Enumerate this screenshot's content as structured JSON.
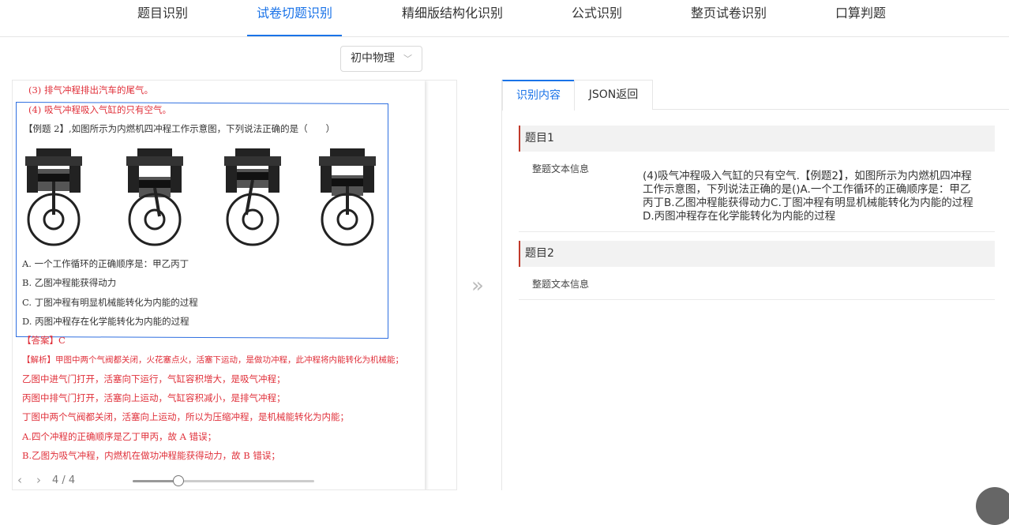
{
  "top_tabs": [
    {
      "label": "题目识别"
    },
    {
      "label": "试卷切题识别"
    },
    {
      "label": "精细版结构化识别"
    },
    {
      "label": "公式识别"
    },
    {
      "label": "整页试卷识别"
    },
    {
      "label": "口算判题"
    }
  ],
  "subject_select": {
    "value": "初中物理"
  },
  "document": {
    "lines": [
      "(3) 排气冲程排出汽车的尾气。",
      "(4) 吸气冲程吸入气缸的只有空气。",
      "【例题 2】,如图所示为内燃机四冲程工作示意图，下列说法正确的是（　　）",
      "A.  一个工作循环的正确顺序是：甲乙丙丁",
      "B.  乙图冲程能获得动力",
      "C.  丁图冲程有明显机械能转化为内能的过程",
      "D.  丙图冲程存在化学能转化为内能的过程",
      "【答案】C",
      "【解析】甲图中两个气阀都关闭，火花塞点火，活塞下运动，是做功冲程，此冲程将内能转化为机械能；",
      "乙图中进气门打开，活塞向下运行，气缸容积增大，是吸气冲程；",
      "丙图中排气门打开，活塞向上运动，气缸容积减小，是排气冲程；",
      "丁图中两个气阀都关闭，活塞向上运动，所以为压缩冲程，是机械能转化为内能；",
      "A.四个冲程的正确顺序是乙丁甲丙，故 A 错误；",
      "B.乙图为吸气冲程，内燃机在做功冲程能获得动力，故 B 错误；"
    ]
  },
  "viewer": {
    "page_indicator": "4 / 4",
    "zoom_fraction": 0.25
  },
  "result_tabs": [
    {
      "label": "识别内容"
    },
    {
      "label": "JSON返回"
    }
  ],
  "questions": [
    {
      "title": "题目1",
      "field_label": "整题文本信息",
      "text": "(4)吸气冲程吸入气缸的只有空气.【例题2】，如图所示为内燃机四冲程工作示意图，下列说法正确的是()A.一个工作循环的正确顺序是：甲乙丙丁B.乙图冲程能获得动力C.丁图冲程有明显机械能转化为内能的过程D.丙图冲程存在化学能转化为内能的过程"
    },
    {
      "title": "题目2",
      "field_label": "整题文本信息",
      "text": ""
    }
  ],
  "colors": {
    "accent": "#1a73e8",
    "answer_red": "#e0303a",
    "selection_blue": "#2f6fe0",
    "question_marker": "#c0392b"
  },
  "icons": [
    "chevron-down-icon",
    "chevron-left-icon",
    "chevron-right-icon",
    "double-chevron-right-icon"
  ]
}
